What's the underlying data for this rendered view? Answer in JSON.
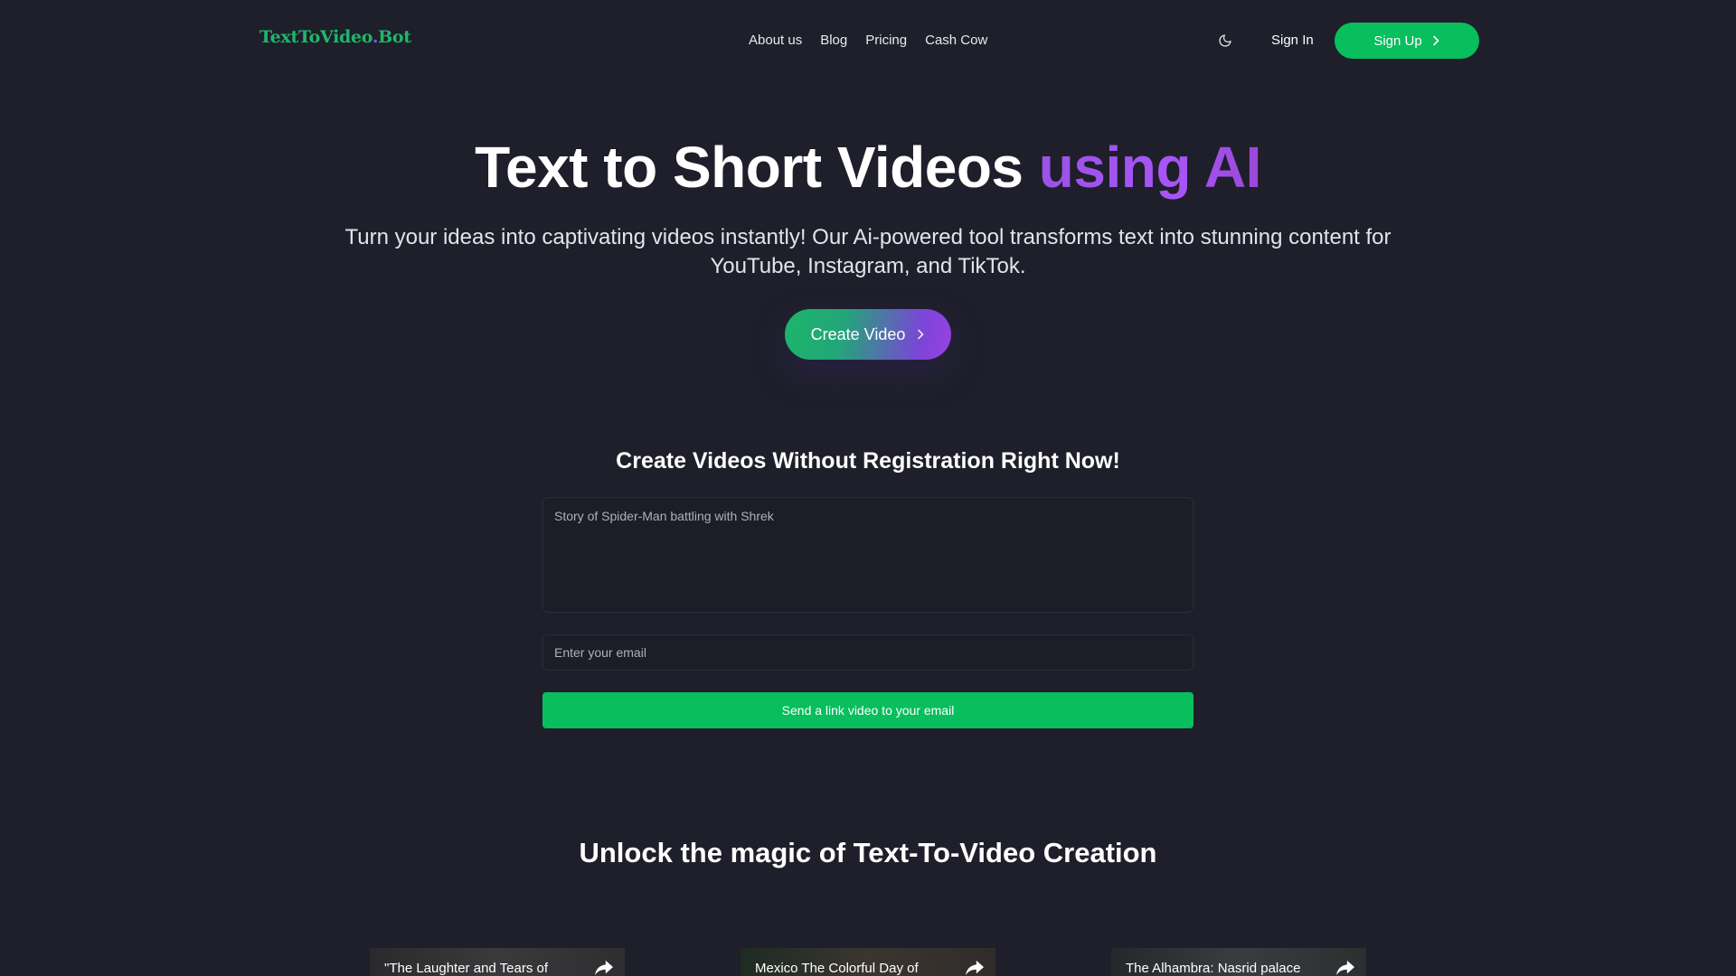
{
  "header": {
    "logo_main": "TextToVideo",
    "logo_accent": ".",
    "logo_tail": "Bot",
    "nav": [
      {
        "label": "About us"
      },
      {
        "label": "Blog"
      },
      {
        "label": "Pricing"
      },
      {
        "label": "Cash Cow"
      }
    ],
    "theme_icon": "moon-icon",
    "sign_in": "Sign In",
    "sign_up": "Sign Up"
  },
  "hero": {
    "title_main": "Text to Short Videos ",
    "title_accent": "using AI",
    "subtitle": "Turn your ideas into captivating videos instantly! Our Ai-powered tool transforms text into stunning content for YouTube, Instagram, and TikTok.",
    "cta": "Create Video"
  },
  "form": {
    "title": "Create Videos Without Registration Right Now!",
    "prompt_placeholder": "Story of Spider-Man battling with Shrek",
    "email_placeholder": "Enter your email",
    "submit": "Send a link video to your email"
  },
  "showcase": {
    "title": "Unlock the magic of Text-To-Video Creation",
    "videos": [
      {
        "title": "\"The Laughter and Tears of"
      },
      {
        "title": "Mexico The Colorful Day of"
      },
      {
        "title": "The Alhambra: Nasrid palace"
      }
    ]
  },
  "colors": {
    "background": "#1e1f2a",
    "brand_green": "#08be5d",
    "brand_purple": "#a855f7"
  }
}
